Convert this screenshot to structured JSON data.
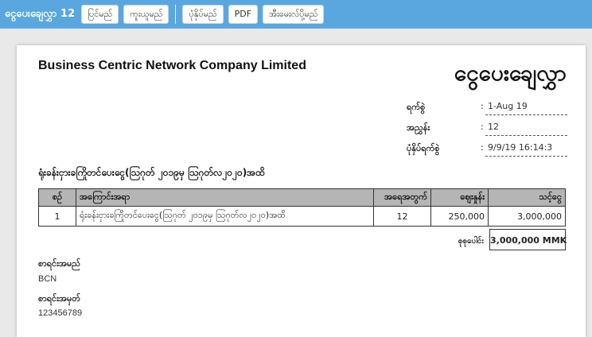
{
  "toolbar": {
    "title": "ငွေပေးချေလွှာ 12",
    "buttons": {
      "edit": "ပြင်မည်",
      "copy": "ကူးယူမည်",
      "print": "ပုံနှိပ်မည်",
      "pdf": "PDF",
      "email": "အီးမေးလ်ပို့မည်"
    }
  },
  "document": {
    "company": "Business Centric Network Company Limited",
    "title": "ငွေပေးချေလွှာ",
    "meta": [
      {
        "label": "ရက်စွဲ",
        "value": "1-Aug 19"
      },
      {
        "label": "အညွှန်း",
        "value": "12"
      },
      {
        "label": "ပုံနှိပ်ရက်စွဲ",
        "value": "9/9/19 16:14:3"
      }
    ],
    "colon": ":",
    "subject": "ရုံးခန်းငှားခကြိုတင်ပေးငွေ(ဩဂုတ် ၂၀၁၉မှ ဩဂုတ်လ၂၀၂၀)အထိ",
    "table": {
      "headers": [
        "စဉ်",
        "အကြောင်းအရာ",
        "အရေအတွက်",
        "ဈေးနှုန်း",
        "သင့်ငွေ"
      ],
      "rows": [
        [
          "1",
          "ရုံးခန်းငှားခကြိုတင်ပေးငွေ(ဩဂုတ် ၂၀၁၉မှ ဩဂုတ်လ၂၀၂၀)အထိ",
          "12",
          "250,000",
          "3,000,000"
        ]
      ]
    },
    "total": {
      "label": "စုစုပေါင်း",
      "value": "3,000,000 MMK"
    },
    "account": {
      "name_label": "စာရင်းအမည်",
      "name_value": "BCN",
      "number_label": "စာရင်းအမှတ်",
      "number_value": "123456789"
    }
  }
}
